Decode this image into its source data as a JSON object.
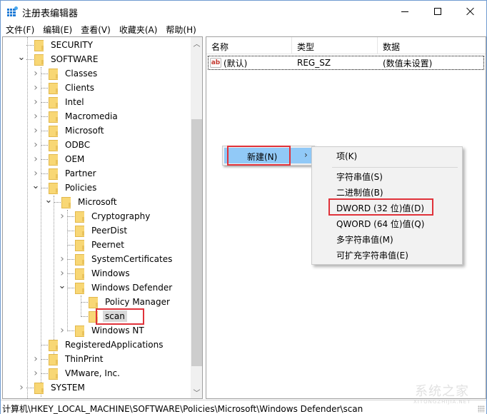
{
  "window": {
    "title": "注册表编辑器",
    "controls": {
      "minimize": "minimize",
      "maximize": "maximize",
      "close": "close"
    }
  },
  "menubar": {
    "items": [
      {
        "label": "文件(F)"
      },
      {
        "label": "编辑(E)"
      },
      {
        "label": "查看(V)"
      },
      {
        "label": "收藏夹(A)"
      },
      {
        "label": "帮助(H)"
      }
    ]
  },
  "tree": {
    "items": [
      {
        "label": "SECURITY",
        "level": 1,
        "expander": "none"
      },
      {
        "label": "SOFTWARE",
        "level": 1,
        "expander": "expanded"
      },
      {
        "label": "Classes",
        "level": 2,
        "expander": "collapsed"
      },
      {
        "label": "Clients",
        "level": 2,
        "expander": "collapsed"
      },
      {
        "label": "Intel",
        "level": 2,
        "expander": "collapsed"
      },
      {
        "label": "Macromedia",
        "level": 2,
        "expander": "collapsed"
      },
      {
        "label": "Microsoft",
        "level": 2,
        "expander": "collapsed"
      },
      {
        "label": "ODBC",
        "level": 2,
        "expander": "collapsed"
      },
      {
        "label": "OEM",
        "level": 2,
        "expander": "collapsed"
      },
      {
        "label": "Partner",
        "level": 2,
        "expander": "collapsed"
      },
      {
        "label": "Policies",
        "level": 2,
        "expander": "expanded"
      },
      {
        "label": "Microsoft",
        "level": 3,
        "expander": "expanded"
      },
      {
        "label": "Cryptography",
        "level": 4,
        "expander": "collapsed"
      },
      {
        "label": "PeerDist",
        "level": 4,
        "expander": "none"
      },
      {
        "label": "Peernet",
        "level": 4,
        "expander": "none"
      },
      {
        "label": "SystemCertificates",
        "level": 4,
        "expander": "collapsed"
      },
      {
        "label": "Windows",
        "level": 4,
        "expander": "collapsed"
      },
      {
        "label": "Windows Defender",
        "level": 4,
        "expander": "expanded"
      },
      {
        "label": "Policy Manager",
        "level": 5,
        "expander": "none"
      },
      {
        "label": "scan",
        "level": 5,
        "expander": "none",
        "selected": true
      },
      {
        "label": "Windows NT",
        "level": 4,
        "expander": "collapsed"
      },
      {
        "label": "RegisteredApplications",
        "level": 2,
        "expander": "none"
      },
      {
        "label": "ThinPrint",
        "level": 2,
        "expander": "collapsed"
      },
      {
        "label": "VMware, Inc.",
        "level": 2,
        "expander": "collapsed"
      },
      {
        "label": "SYSTEM",
        "level": 1,
        "expander": "collapsed"
      }
    ]
  },
  "list": {
    "columns": [
      {
        "label": "名称"
      },
      {
        "label": "类型"
      },
      {
        "label": "数据"
      }
    ],
    "rows": [
      {
        "icon": "ab",
        "name": "(默认)",
        "type": "REG_SZ",
        "data": "(数值未设置)"
      }
    ]
  },
  "context_menu": {
    "parent_item": {
      "label": "新建(N)",
      "arrow": "›"
    },
    "submenu": [
      {
        "label": "项(K)"
      },
      {
        "label": "字符串值(S)"
      },
      {
        "label": "二进制值(B)"
      },
      {
        "label": "DWORD (32 位)值(D)",
        "highlighted": true
      },
      {
        "label": "QWORD (64 位)值(Q)"
      },
      {
        "label": "多字符串值(M)"
      },
      {
        "label": "可扩充字符串值(E)"
      }
    ]
  },
  "statusbar": {
    "path": "计算机\\HKEY_LOCAL_MACHINE\\SOFTWARE\\Policies\\Microsoft\\Windows Defender\\scan"
  },
  "watermark": {
    "text": "系统之家",
    "sub": "XITONGZHIJIA.NET"
  },
  "colors": {
    "highlight_box": "#e0323a",
    "menu_hover": "#91c9f7",
    "folder": "#f8d775",
    "window_border": "#6f9bd1"
  }
}
